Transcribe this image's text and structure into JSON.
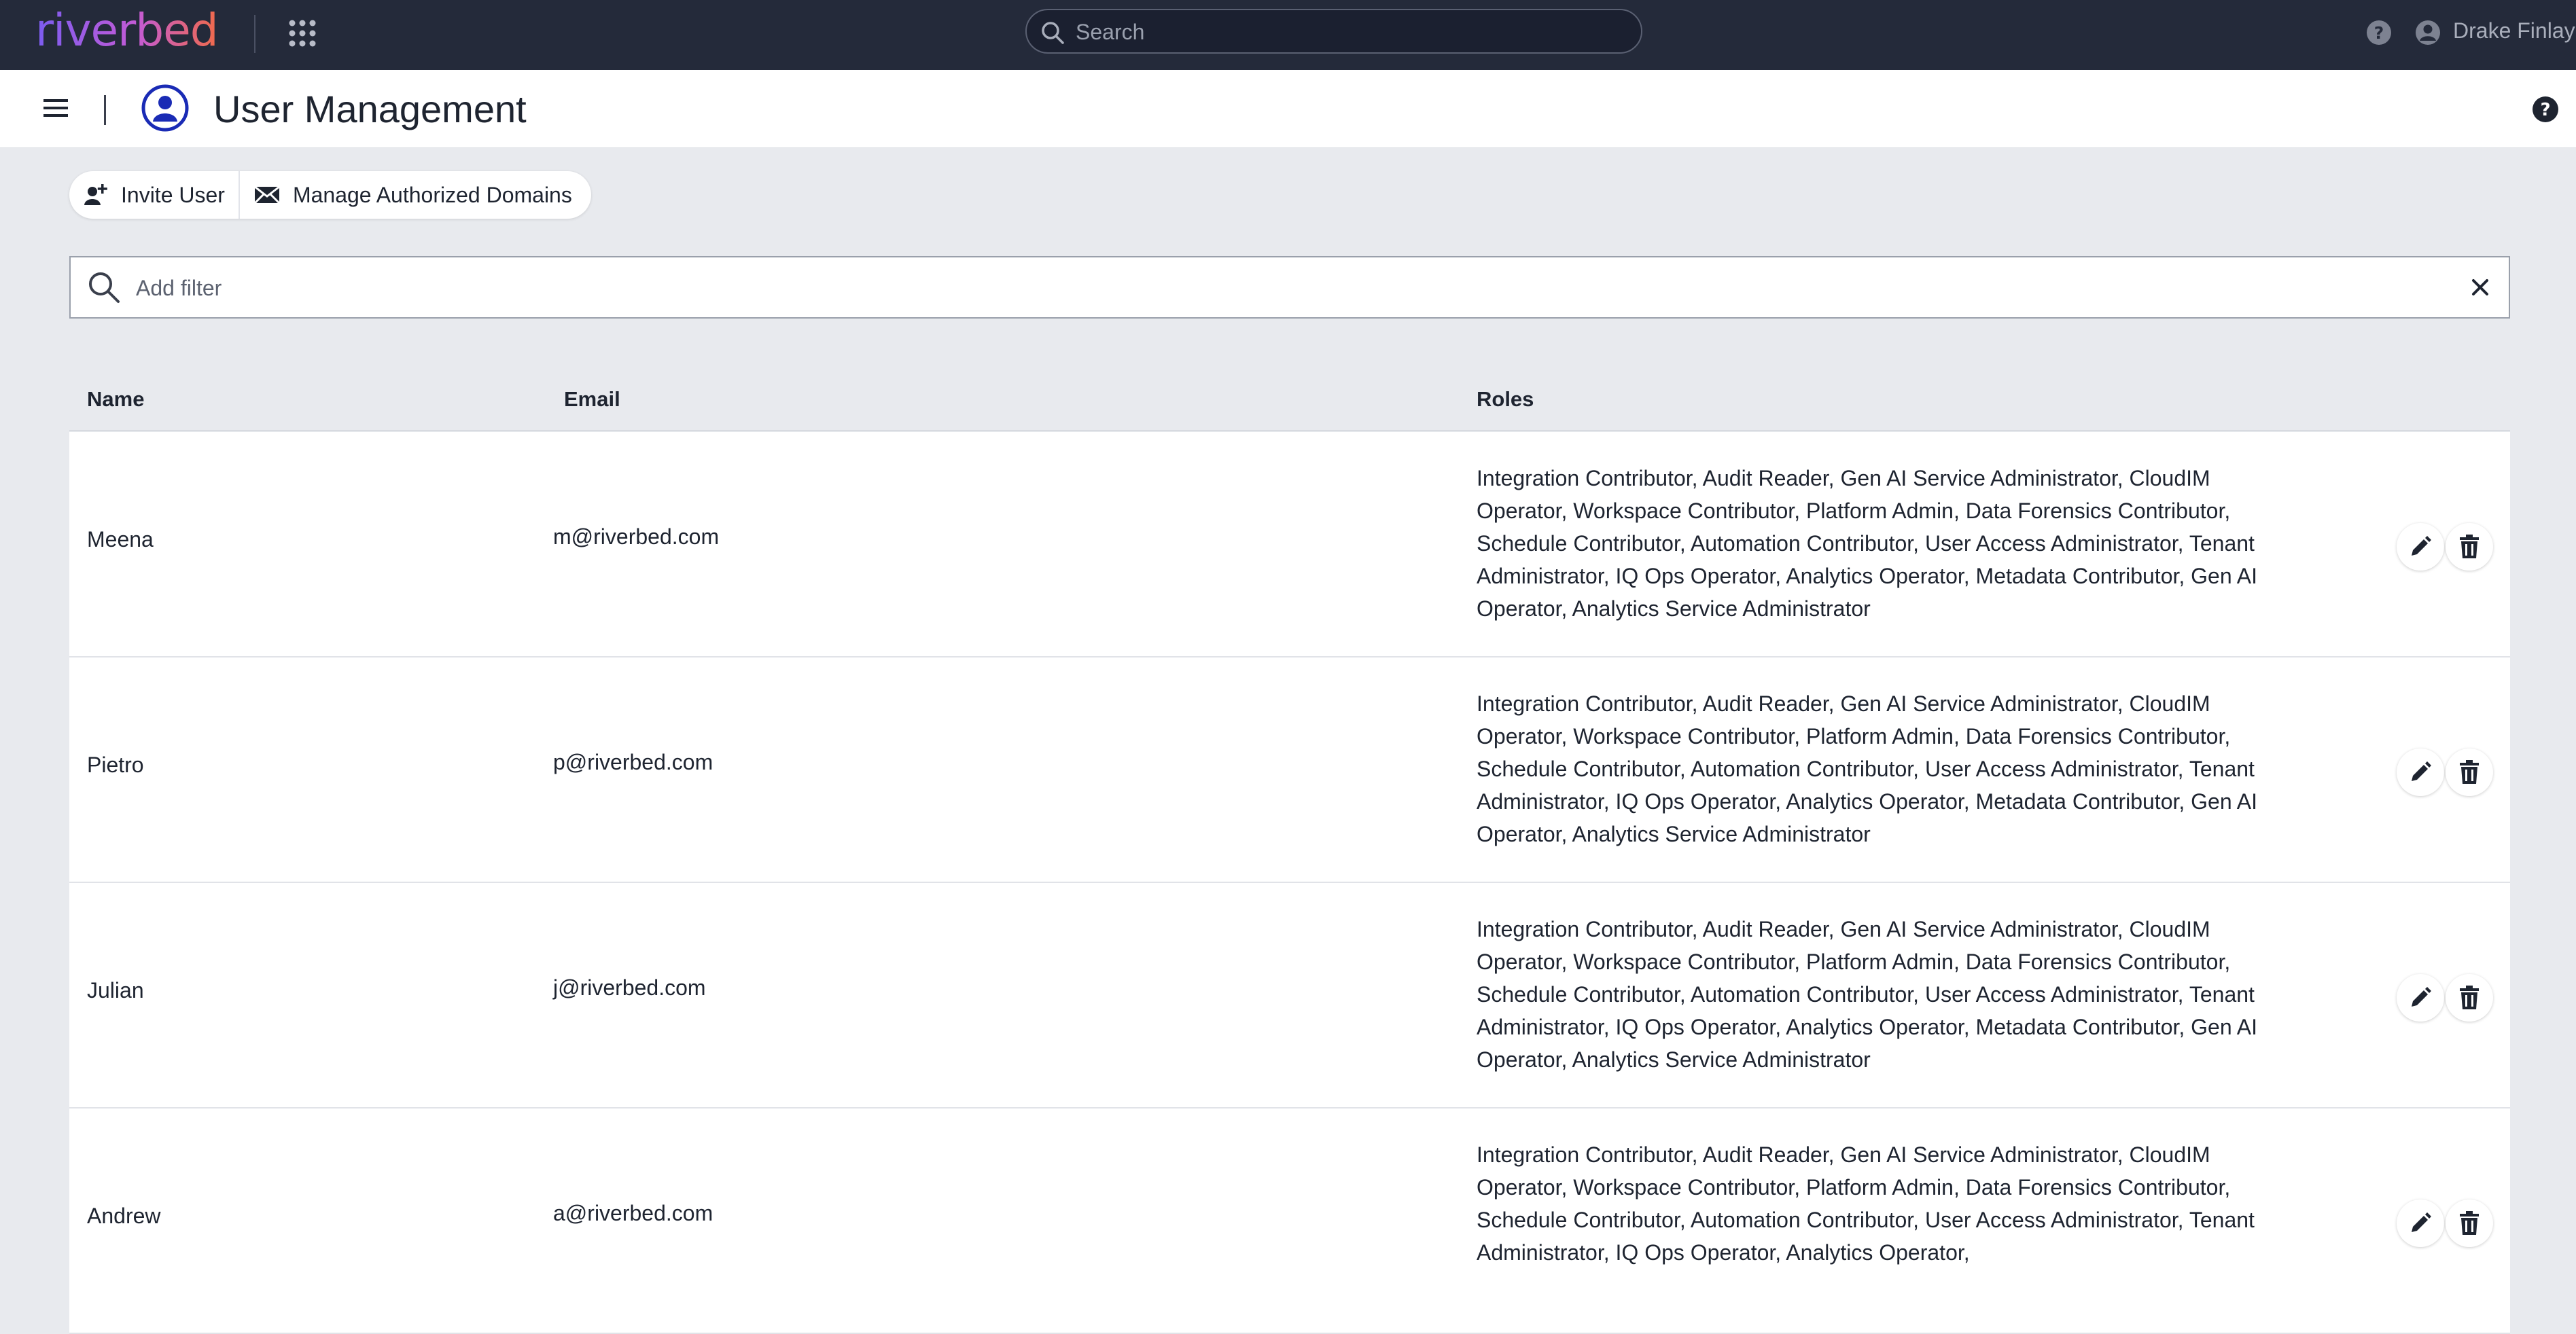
{
  "topbar": {
    "logo": "riverbed",
    "search_placeholder": "Search",
    "user_name": "Drake Finlay"
  },
  "header": {
    "title": "User Management"
  },
  "toolbar": {
    "invite_label": "Invite User",
    "domains_label": "Manage Authorized Domains"
  },
  "filter": {
    "placeholder": "Add filter"
  },
  "table": {
    "columns": [
      "Name",
      "Email",
      "Roles"
    ],
    "rows": [
      {
        "name": "Meena",
        "email": "m@riverbed.com",
        "roles": "Integration Contributor, Audit Reader, Gen AI Service Administrator, CloudIM Operator, Workspace Contributor, Platform Admin, Data Forensics Contributor, Schedule Contributor, Automation Contributor, User Access Administrator, Tenant Administrator, IQ Ops Operator, Analytics Operator, Metadata Contributor, Gen AI Operator, Analytics Service Administrator"
      },
      {
        "name": "Pietro",
        "email": "p@riverbed.com",
        "roles": "Integration Contributor, Audit Reader, Gen AI Service Administrator, CloudIM Operator, Workspace Contributor, Platform Admin, Data Forensics Contributor, Schedule Contributor, Automation Contributor, User Access Administrator, Tenant Administrator, IQ Ops Operator, Analytics Operator, Metadata Contributor, Gen AI Operator, Analytics Service Administrator"
      },
      {
        "name": "Julian",
        "email": "j@riverbed.com",
        "roles": "Integration Contributor, Audit Reader, Gen AI Service Administrator, CloudIM Operator, Workspace Contributor, Platform Admin, Data Forensics Contributor, Schedule Contributor, Automation Contributor, User Access Administrator, Tenant Administrator, IQ Ops Operator, Analytics Operator, Metadata Contributor, Gen AI Operator, Analytics Service Administrator"
      },
      {
        "name": "Andrew",
        "email": "a@riverbed.com",
        "roles": "Integration Contributor, Audit Reader, Gen AI Service Administrator, CloudIM Operator, Workspace Contributor, Platform Admin, Data Forensics Contributor, Schedule Contributor, Automation Contributor, User Access Administrator, Tenant Administrator, IQ Ops Operator, Analytics Operator,"
      }
    ]
  },
  "icons": [
    "apps-grid-icon",
    "search-icon",
    "help-icon",
    "user-icon",
    "menu-icon",
    "user-management-icon",
    "invite-user-icon",
    "mail-icon",
    "clear-icon",
    "edit-icon",
    "delete-icon"
  ],
  "colors": {
    "topbar_bg": "#242a3a",
    "page_bg": "#e8eaee",
    "accent_blue": "#1a2bb5"
  }
}
